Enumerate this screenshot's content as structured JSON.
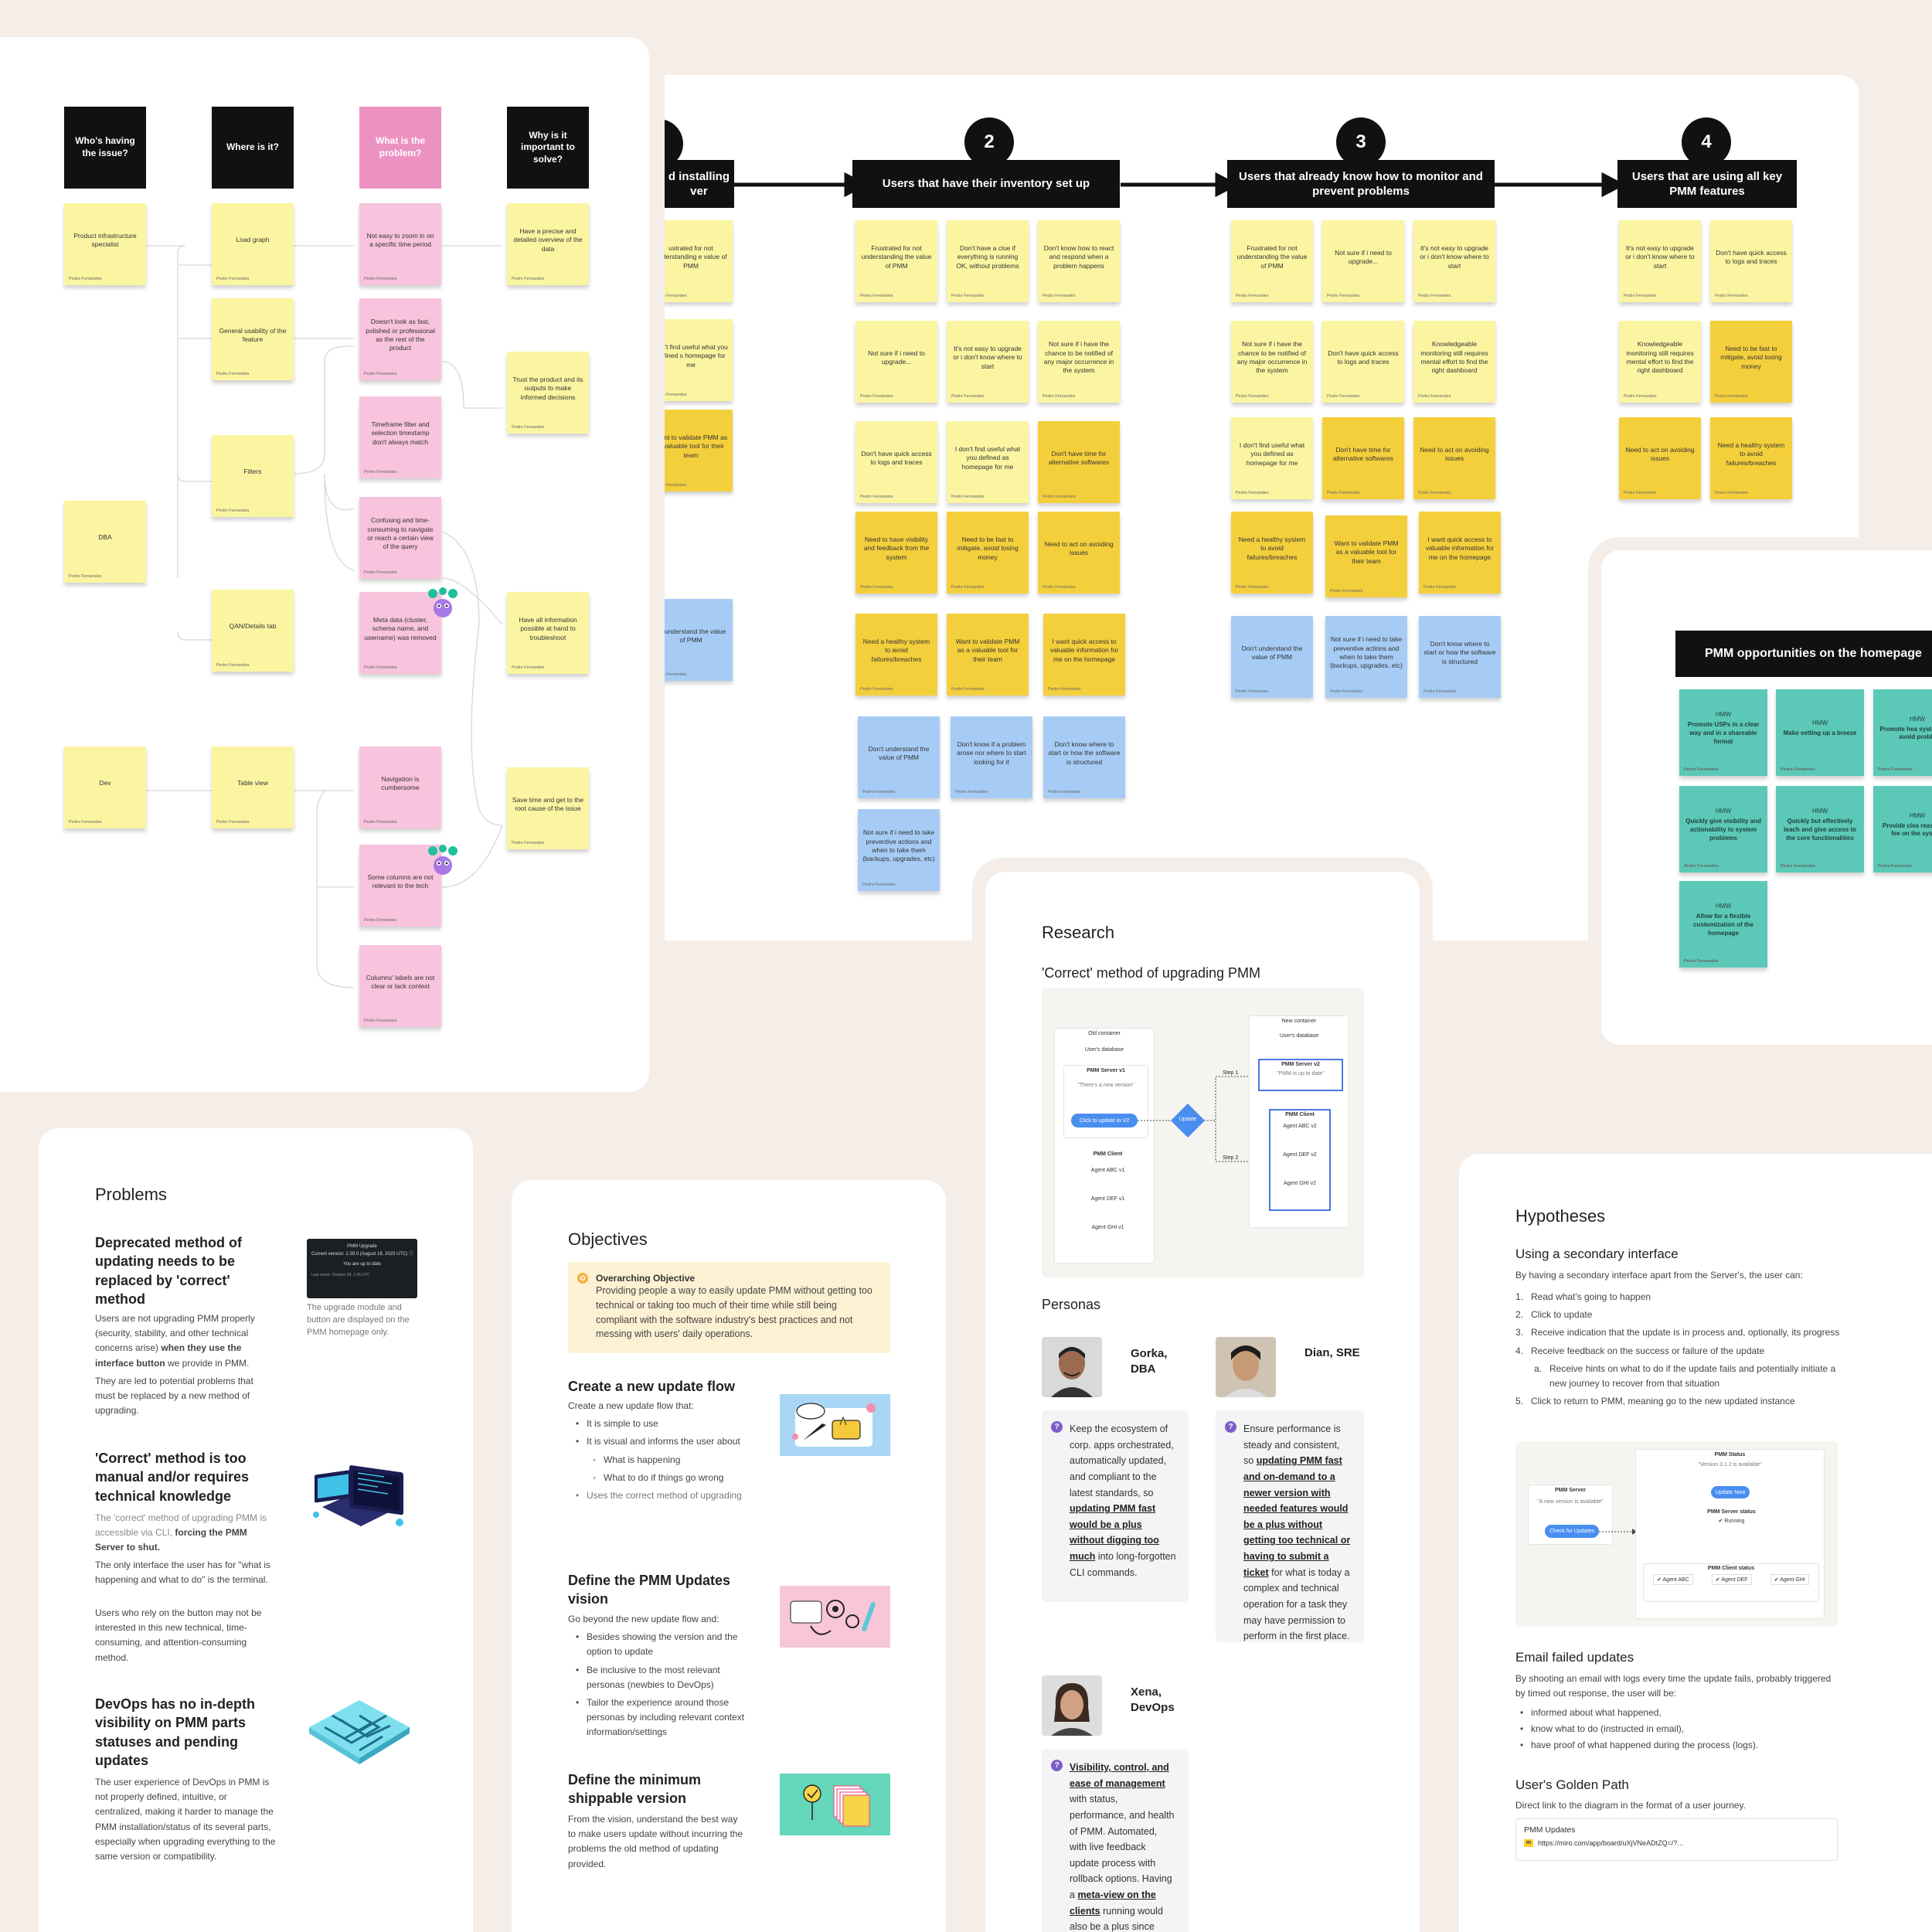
{
  "affinity_map": {
    "columns": [
      {
        "title": "Who's having the issue?",
        "color": "#111111"
      },
      {
        "title": "Where is it?",
        "color": "#111111"
      },
      {
        "title": "What is the problem?",
        "color": "#ec92c2"
      },
      {
        "title": "Why is it important to solve?",
        "color": "#111111"
      }
    ],
    "who": [
      "Product infrastructure specialist",
      "DBA",
      "Dev"
    ],
    "where": [
      "Load graph",
      "General usability of the feature",
      "Filters",
      "QAN/Details tab",
      "Table view"
    ],
    "what": [
      "Not easy to zoom in on a specific time period",
      "Doesn't look as fast, polished or professional as the rest of the product",
      "Timeframe filter and selection timestamp don't always match",
      "Confusing and time-consuming to navigate or reach a certain view of the query",
      "Meta data (cluster, schema name, and username) was removed",
      "Navigation is cumbersome",
      "Some columns are not relevant to the tech",
      "Columns' labels are not clear or lack context"
    ],
    "why": [
      "Have a precise and detailed overview of the data",
      "Trust the product and its outputs to make informed decisions",
      "Have all information possible at hand to troubleshoot",
      "Save time and get to the root cause of the issue"
    ],
    "author": "Pedro Fernandes"
  },
  "journey": {
    "steps": [
      {
        "num": "2",
        "title": "Users that have their inventory set up"
      },
      {
        "num": "3",
        "title": "Users that already know how to monitor and prevent problems"
      },
      {
        "num": "4",
        "title": "Users that are using all key PMM features"
      }
    ],
    "step1_partial_title": "d installing\nver",
    "step1_notes": [
      "ustrated for not understanding e value of PMM",
      "don't find useful what you defined s homepage for me",
      "Want to validate PMM as a valuable tool for their team",
      "n't understand the value of PMM"
    ],
    "step2_notes": [
      "Frustrated for not understanding the value of PMM",
      "Don't have a clue if everything is running OK, without problems",
      "Don't know how to react and respond when a problem happens",
      "Not sure if i need to upgrade...",
      "It's not easy to upgrade or i don't know where to start",
      "Not sure if i have the chance to be notified of any major occurrence in the system",
      "Don't have quick access to logs and traces",
      "I don't find useful what you defined as homepage for me",
      "Don't have time for alternative softwares",
      "Need to have visibility and feedback from the system",
      "Need to be fast to mitigate, avoid losing money",
      "Need to act on avoiding issues",
      "Need a healthy system to avoid failures/breaches",
      "Want to validate PMM as a valuable tool for their team",
      "I want quick access to valuable information for me on the homepage",
      "Don't understand the value of PMM",
      "Don't know if a problem arose nor where to start looking for it",
      "Don't know where to start or how the software is structured",
      "Not sure if i need to take preventive actions and when to take them (backups, upgrades, etc)"
    ],
    "step3_notes": [
      "Frustrated for not understanding the value of PMM",
      "Not sure if i need to upgrade...",
      "It's not easy to upgrade or i don't know where to start",
      "Not sure if i have the chance to be notified of any major occurrence in the system",
      "Don't have quick access to logs and traces",
      "Knowledgeable monitoring still requires mental effort to find the right dashboard",
      "I don't find useful what you defined as homepage for me",
      "Don't have time for alternative softwares",
      "Need to act on avoiding issues",
      "Need a healthy system to avoid failures/breaches",
      "Want to validate PMM as a valuable tool for their team",
      "I want quick access to valuable information for me on the homepage",
      "Don't understand the value of PMM",
      "Not sure if i need to take preventive actions and when to take them (backups, upgrades, etc)",
      "Don't know where to start or how the software is structured"
    ],
    "step4_notes": [
      "It's not easy to upgrade or i don't know where to start",
      "Don't have quick access to logs and traces",
      "Knowledgeable monitoring still requires mental effort to find the right dashboard",
      "Need to be fast to mitigate, avoid losing money",
      "Need to act on avoiding issues",
      "Need a healthy system to avoid failures/breaches"
    ]
  },
  "opportunities": {
    "title": "PMM opportunities on the homepage",
    "hmw": "HMW",
    "notes": [
      "Promote USPs in a clear way and in a shareable format",
      "Make setting up a breeze",
      "Promote hea system habi avoid proble",
      "Quickly give visibility and actionability to system problems",
      "Quickly but effectively teach and give access to the core functionalities",
      "Provide clea reassuring fee on the system",
      "Allow for a flexible customization of the homepage"
    ]
  },
  "problems": {
    "title": "Problems",
    "screenshot": {
      "title": "PMM Upgrade",
      "line": "Current version: 2.39.0 (August 18, 2023 UTC) ⓘ",
      "status": "You are up to date",
      "checked": "Last check: October 24, 1:36 UTC"
    },
    "caption": "The upgrade module and button are displayed on the PMM homepage only.",
    "items": [
      {
        "heading": "Deprecated method of updating needs to be replaced by 'correct' method",
        "p1a": "Users are not upgrading PMM properly (security, stability, and other technical concerns arise) ",
        "p1b": "when they use the interface button",
        "p1c": " we provide in PMM.",
        "p2": "They are led to potential problems that must be replaced by a new method of upgrading."
      },
      {
        "heading": "'Correct' method is too manual and/or requires technical knowledge",
        "p1a": "The 'correct' method of upgrading PMM is accessible via CLI, ",
        "p1b": "forcing the PMM Server to shut.",
        "p2": "The only interface the user has for \"what is happening and what to do\" is the terminal.",
        "p3": "Users who rely on the button may not be interested in this new technical, time-consuming, and attention-consuming method."
      },
      {
        "heading": "DevOps has no in-depth visibility on PMM parts statuses and pending updates",
        "p1": "The user experience of DevOps in PMM is not properly defined, intuitive, or centralized, making it harder to manage the PMM installation/status of its several parts, especially when upgrading everything to the same version or compatibility."
      }
    ]
  },
  "objectives": {
    "title": "Objectives",
    "overarching_label": "Overarching Objective",
    "overarching_text": "Providing people a way to easily update PMM without getting too technical or taking too much of their time while still being compliant with the software industry's best practices and not messing with users' daily operations.",
    "sections": [
      {
        "heading": "Create a new update flow",
        "intro": "Create a new update flow that:",
        "b1": "It is simple to use",
        "b2": "It is visual and informs the user about",
        "b2a": "What is happening",
        "b2b": "What to do if things go wrong",
        "b3": "Uses the correct method of upgrading"
      },
      {
        "heading": "Define the PMM Updates vision",
        "intro": "Go beyond the new update flow and:",
        "b1": "Besides showing the version and the option to update",
        "b2": "Be inclusive to the most relevant personas (newbies to DevOps)",
        "b3": "Tailor the experience around those personas by including relevant context information/settings"
      },
      {
        "heading": "Define the minimum shippable version",
        "intro": "From the vision, understand the best way to make users update without incurring the problems the old method of updating provided."
      }
    ]
  },
  "research": {
    "title": "Research",
    "subtitle": "'Correct' method of upgrading PMM",
    "diagram": {
      "old_container": "Old container",
      "users_db": "User's database",
      "server_v1": "PMM Server v1",
      "new_version_msg": "\"There's a new version\"",
      "click_update": "Click to update to V2",
      "client": "PMM Client",
      "agents_v1": [
        "Agent ABC v1",
        "Agent DEF v1",
        "Agent GHI v1"
      ],
      "update": "Update",
      "step1": "Step 1",
      "step2": "Step 2",
      "new_container": "New container",
      "server_v2": "PMM Server v2",
      "up_to_date": "\"PMM is up to date\"",
      "agents_v2": [
        "Agent ABC v2",
        "Agent DEF v2",
        "Agent GHI v2"
      ]
    },
    "personas_title": "Personas",
    "personas": [
      {
        "name": "Gorka,\nDBA",
        "t1": "Keep the ecosystem of corp. apps orchestrated, automatically updated, and compliant to the latest standards, so ",
        "t2": "updating PMM fast would be a plus without digging too much",
        "t3": " into long-forgotten CLI commands."
      },
      {
        "name": "Dian, SRE",
        "t1": "Ensure performance is steady and consistent, so ",
        "t2": "updating PMM fast and on-demand to a newer version with needed features would be a plus without getting too technical or having to submit a ticket",
        "t3": " for what is today a complex and technical operation for a task they may have permission to perform in the first place."
      },
      {
        "name": "Xena,\nDevOps",
        "t1": "",
        "t2": "Visibility, control, and ease of management",
        "t3": " with status, performance, and health of PMM. Automated, with live feedback update process with rollback options. Having a ",
        "t4": "meta-view on the clients",
        "t5": " running would also be a plus since"
      }
    ]
  },
  "hypotheses": {
    "title": "Hypotheses",
    "s1_heading": "Using a secondary interface",
    "s1_intro": "By having a secondary interface apart from the Server's, the user can:",
    "list": [
      "Read what's going to happen",
      "Click to update",
      "Receive indication that the update is in process and, optionally, its progress",
      "Receive feedback on the success or failure of the update",
      "Click to return to PMM, meaning go to the new updated instance"
    ],
    "sublist": "Receive hints on what to do if the update fails and potentially initiate a new journey to recover from that situation",
    "diagram": {
      "server": "PMM Server",
      "avail_msg": "\"A new version is available\"",
      "check_btn": "Check for Updates",
      "status": "PMM Status",
      "version_msg": "\"Version 3.1.2 is available\"",
      "update_btn": "Update Now",
      "server_status": "PMM Server status",
      "running": "✔ Running",
      "client_status": "PMM Client status",
      "agents": [
        "✔ Agent ABC",
        "✔ Agent DEF",
        "✔ Agent GHI"
      ]
    },
    "s2_heading": "Email failed updates",
    "s2_intro": "By shooting an email with logs every time the update fails, probably triggered by timed out response, the user will be:",
    "s2_list": [
      "informed about what happened,",
      "know what to do (instructed in email),",
      "have proof of what happened during the process (logs)."
    ],
    "s3_heading": "User's Golden Path",
    "s3_intro": "Direct link to the diagram in the format of a user journey.",
    "link_title": "PMM Updates",
    "link_url": "https://miro.com/app/board/uXjVNeADtZQ=/?..."
  }
}
